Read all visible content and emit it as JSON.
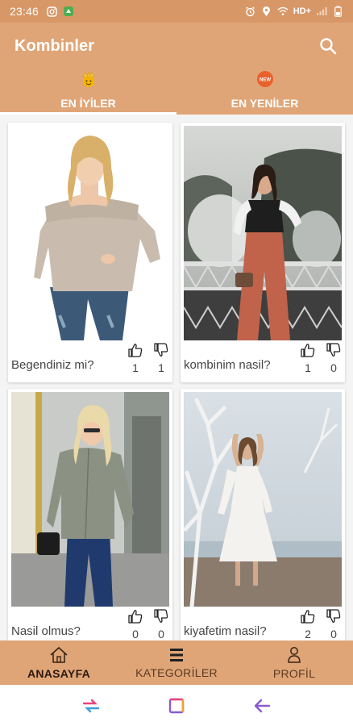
{
  "status_bar": {
    "time": "23:46",
    "network_label": "HD+"
  },
  "app_bar": {
    "title": "Kombinler",
    "search_icon": "search-icon"
  },
  "tabs": [
    {
      "label": "EN İYİLER",
      "icon": "crown-emoji-icon",
      "active": true
    },
    {
      "label": "EN YENİLER",
      "icon": "new-badge-icon",
      "active": false
    }
  ],
  "cards": [
    {
      "caption": "Begendiniz mi?",
      "likes": "1",
      "dislikes": "1",
      "image": "woman-beige-sweater-photo"
    },
    {
      "caption": "kombinim nasil?",
      "likes": "1",
      "dislikes": "0",
      "image": "woman-rust-trousers-photo"
    },
    {
      "caption": "Nasil olmus?",
      "likes": "0",
      "dislikes": "0",
      "image": "woman-grey-shirt-photo"
    },
    {
      "caption": "kiyafetim nasil?",
      "likes": "2",
      "dislikes": "0",
      "image": "woman-white-dress-photo"
    }
  ],
  "bottom_nav": [
    {
      "label": "ANASAYFA",
      "icon": "home-icon",
      "active": true
    },
    {
      "label": "KATEGORİLER",
      "icon": "menu-lines-icon",
      "active": false
    },
    {
      "label": "PROFİL",
      "icon": "user-icon",
      "active": false
    }
  ],
  "colors": {
    "primary": "#e0a577",
    "status": "#d89767",
    "grid_bg": "#f4f4f4"
  }
}
